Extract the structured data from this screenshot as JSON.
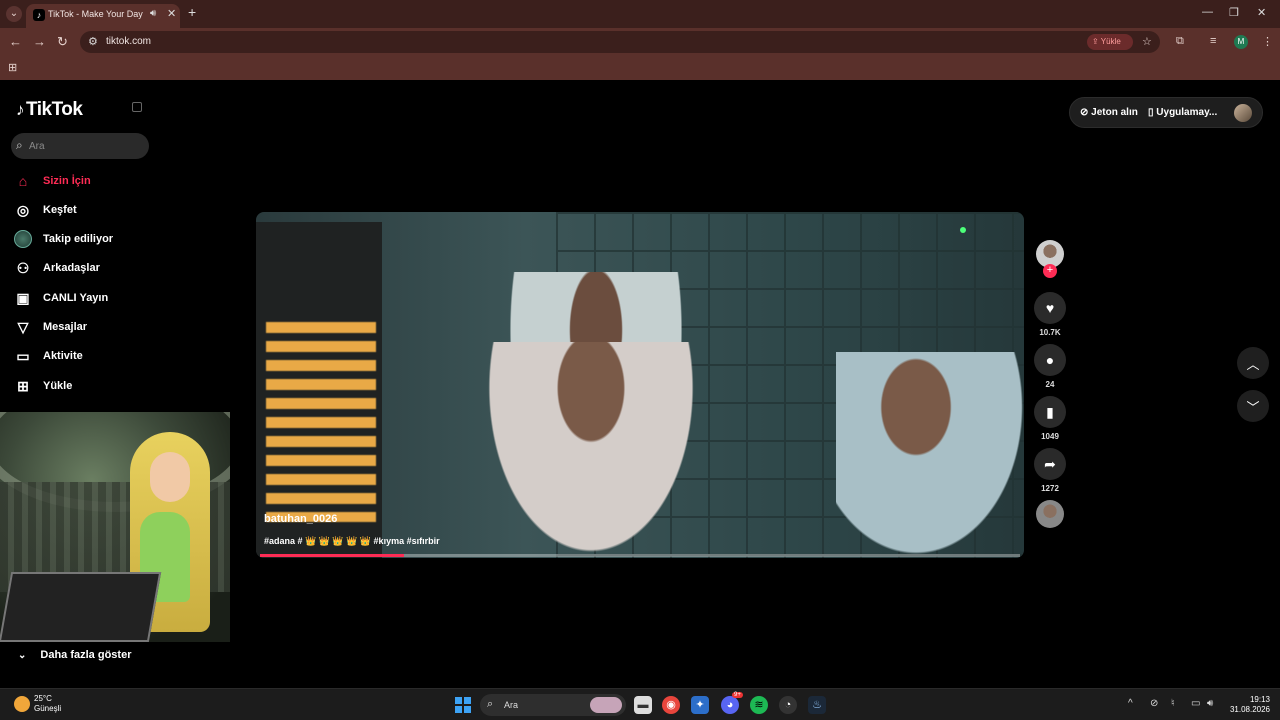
{
  "browser": {
    "tab_title": "TikTok - Make Your Day",
    "url": "tiktok.com",
    "yukle_chip": "Yükle",
    "profile_initial": "M"
  },
  "sidebar": {
    "logo": "TikTok",
    "search_placeholder": "Ara",
    "items": [
      {
        "label": "Sizin İçin",
        "icon": "home-icon",
        "active": true
      },
      {
        "label": "Keşfet",
        "icon": "compass-icon"
      },
      {
        "label": "Takip ediliyor",
        "icon": "following-avatar-icon"
      },
      {
        "label": "Arkadaşlar",
        "icon": "friends-icon"
      },
      {
        "label": "CANLI Yayın",
        "icon": "live-icon"
      },
      {
        "label": "Mesajlar",
        "icon": "messages-icon"
      },
      {
        "label": "Aktivite",
        "icon": "activity-icon"
      },
      {
        "label": "Yükle",
        "icon": "upload-icon"
      }
    ],
    "more_label": "Daha fazla göster"
  },
  "header": {
    "coins_label": "Jeton alın",
    "app_label": "Uygulamay..."
  },
  "video": {
    "username": "batuhan_0026",
    "caption": "#adana # 👑 👑 👑 👑 👑 #kıyma #sıfırbir",
    "progress": 0.19
  },
  "actions": {
    "likes": "10.7K",
    "comments": "24",
    "saves": "1049",
    "shares": "1272"
  },
  "taskbar": {
    "temperature": "25°C",
    "weather": "Güneşli",
    "search_label": "Ara",
    "time": "19:13",
    "date": "31.08.2026",
    "discord_badge": "9+"
  },
  "colors": {
    "accent": "#fe2c55",
    "browser_frame": "#5a302b"
  }
}
